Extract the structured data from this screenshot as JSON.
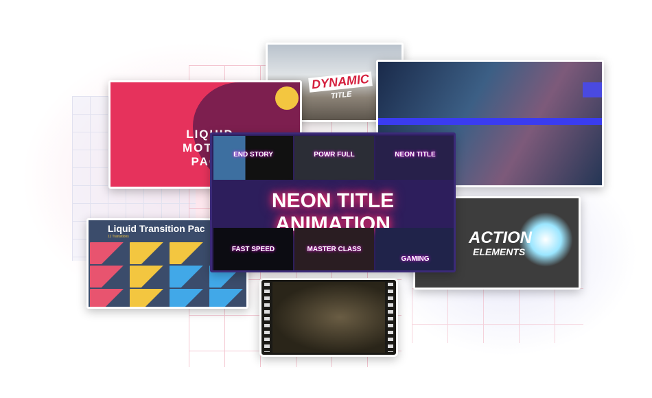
{
  "cards": {
    "dynamic": {
      "title": "DYNAMIC",
      "subtitle": "TITLE"
    },
    "liquid_motion": {
      "title": "LIQUID MOTION",
      "subtitle": "PACK"
    },
    "neon": {
      "title": "NEON TITLE  ANIMATION",
      "tiles": [
        "END STORY",
        "POWR FULL",
        "NEON TITLE",
        "FAST SPEED",
        "MASTER CLASS",
        "GAMING"
      ]
    },
    "action": {
      "title": "ACTION",
      "subtitle": "ELEMENTS"
    },
    "liquid_transition": {
      "title": "Liquid Transition Pac",
      "subtitle": "11 Transitions",
      "colors": [
        "#e8546f",
        "#f3c640",
        "#f3c640",
        "#3b4c6b",
        "#e8546f",
        "#f3c640",
        "#41a8e8",
        "#41a8e8",
        "#e8546f",
        "#f3c640",
        "#41a8e8",
        "#41a8e8"
      ]
    }
  },
  "colors": {
    "grid": "#f2b8c6",
    "neon_glow": "#ff2a6a",
    "neon_bg": "#2d1e5c"
  }
}
